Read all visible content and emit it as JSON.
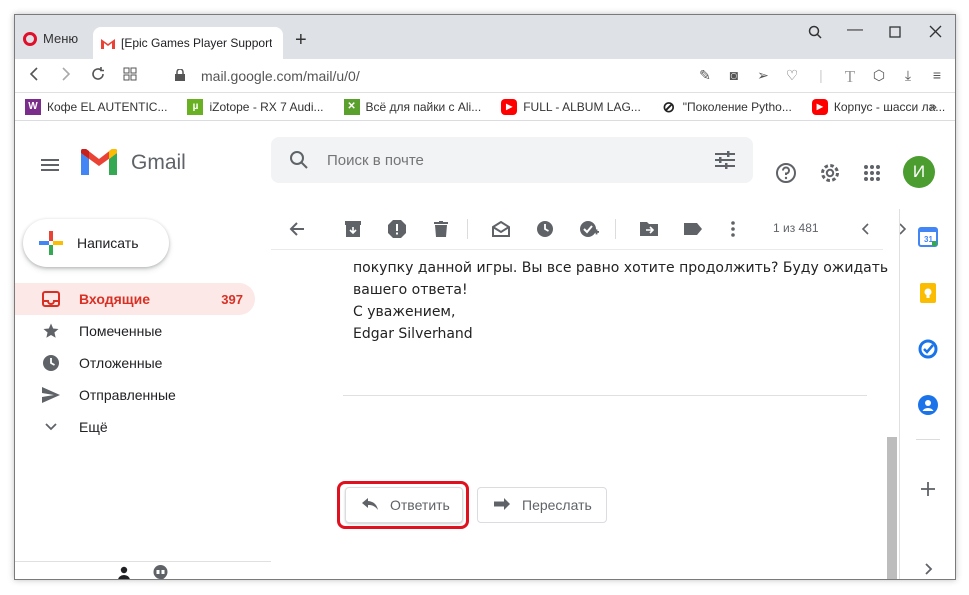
{
  "browser": {
    "menu_label": "Меню",
    "tab_title": "[Epic Games Player Support",
    "url": "mail.google.com/mail/u/0/",
    "bookmarks": [
      {
        "label": "Кофе EL AUTENTIC...",
        "icon": "W",
        "color": "#7b2d8b"
      },
      {
        "label": "iZotope - RX 7 Audi...",
        "icon": "µ",
        "color": "#6ab023"
      },
      {
        "label": "Всё для пайки с Ali...",
        "icon": "✕",
        "color": "#5aa02c"
      },
      {
        "label": "FULL - ALBUM LAG...",
        "icon": "▶",
        "color": "#ff0000"
      },
      {
        "label": "\"Поколение Pytho...",
        "icon": "⊘",
        "color": "#222222"
      },
      {
        "label": "Корпус - шасси ла...",
        "icon": "▶",
        "color": "#ff0000"
      }
    ]
  },
  "gmail": {
    "brand": "Gmail",
    "search_placeholder": "Поиск в почте",
    "avatar_letter": "И",
    "compose_label": "Написать",
    "nav": [
      {
        "label": "Входящие",
        "count": "397",
        "icon": "inbox-icon"
      },
      {
        "label": "Помеченные",
        "count": "",
        "icon": "star-icon"
      },
      {
        "label": "Отложенные",
        "count": "",
        "icon": "clock-icon"
      },
      {
        "label": "Отправленные",
        "count": "",
        "icon": "send-icon"
      },
      {
        "label": "Ещё",
        "count": "",
        "icon": "chevron-down-icon"
      }
    ],
    "pager": "1 из 481",
    "message_lines": [
      "покупку данной игры. Вы все равно хотите продолжить? Буду ожидать",
      "вашего ответа!",
      "С уважением,",
      "Edgar Silverhand"
    ],
    "reply_label": "Ответить",
    "forward_label": "Переслать"
  },
  "colors": {
    "highlight": "#e0101e",
    "active_nav_bg": "#fce8e6",
    "active_nav_text": "#d93025",
    "avatar_bg": "#4a9d2e"
  }
}
